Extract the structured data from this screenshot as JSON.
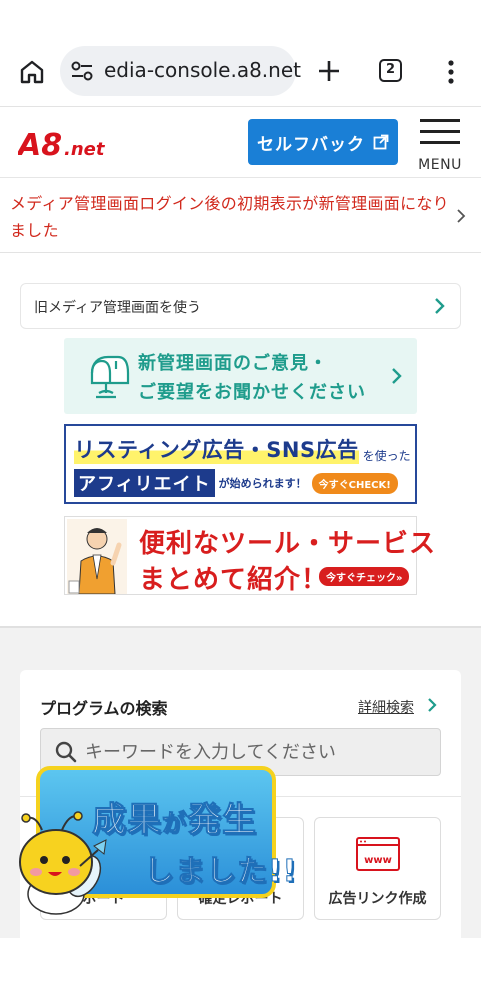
{
  "browser": {
    "url": "edia-console.a8.net",
    "tab_count": "2"
  },
  "header": {
    "logo_text": "A8.net",
    "selfback_label": "セルフバック",
    "menu_label": "MENU"
  },
  "notice": {
    "text": "メディア管理画面ログイン後の初期表示が新管理画面になりました"
  },
  "main": {
    "old_ui_label": "旧メディア管理画面を使う",
    "feedback_line1": "新管理画面のご意見・",
    "feedback_line2": "ご要望をお聞かせください",
    "banner_listing": {
      "headline": "リスティング広告・SNS広告",
      "headline_tail": "を使った",
      "boxed": "アフィリエイト",
      "tail": "が始められます！",
      "cta": "今すぐCHECK!"
    },
    "banner_tools": {
      "line1": "便利なツール・サービス",
      "line2": "まとめて紹介！",
      "cta": "今すぐチェック»"
    }
  },
  "search": {
    "title": "プログラムの検索",
    "advanced_link": "詳細検索",
    "placeholder": "キーワードを入力してください",
    "tiles": [
      {
        "label": "ポート"
      },
      {
        "label": "確定レポート"
      },
      {
        "label": "広告リンク作成",
        "icon_text": "www"
      }
    ]
  },
  "badge": {
    "line1_a": "成果",
    "line1_b": "が",
    "line1_c": "発生",
    "line2": "しました!!"
  }
}
